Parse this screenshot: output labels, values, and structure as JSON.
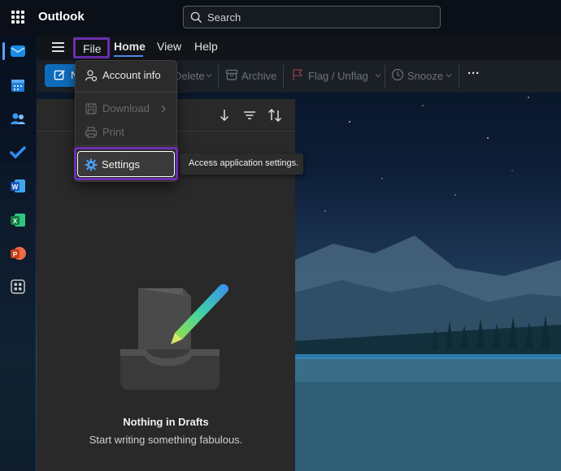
{
  "app": {
    "title": "Outlook"
  },
  "search": {
    "placeholder": "Search"
  },
  "ribbon": {
    "tabs": [
      {
        "label": "File"
      },
      {
        "label": "Home"
      },
      {
        "label": "View"
      },
      {
        "label": "Help"
      }
    ],
    "toolbar": {
      "new_label": "N",
      "delete_label": "Delete",
      "archive_label": "Archive",
      "flag_label": "Flag / Unflag",
      "snooze_label": "Snooze",
      "more_label": "···"
    }
  },
  "file_menu": {
    "items": [
      {
        "label": "Account info",
        "icon": "account-icon",
        "enabled": true
      },
      {
        "label": "Download",
        "icon": "save-icon",
        "enabled": false
      },
      {
        "label": "Print",
        "icon": "printer-icon",
        "enabled": false
      },
      {
        "label": "Settings",
        "icon": "gear-icon",
        "enabled": true
      }
    ]
  },
  "tooltip": {
    "text": "Access application settings."
  },
  "message_list": {
    "empty_title": "Nothing in Drafts",
    "empty_subtitle": "Start writing something fabulous."
  },
  "rail": {
    "items": [
      "mail-icon",
      "calendar-icon",
      "people-icon",
      "todo-icon",
      "word-icon",
      "excel-icon",
      "powerpoint-icon",
      "more-apps-icon"
    ]
  },
  "colors": {
    "accent": "#0f6cbd",
    "highlight_outline": "#6b2fb0",
    "tab_underline": "#4f8ef7"
  }
}
